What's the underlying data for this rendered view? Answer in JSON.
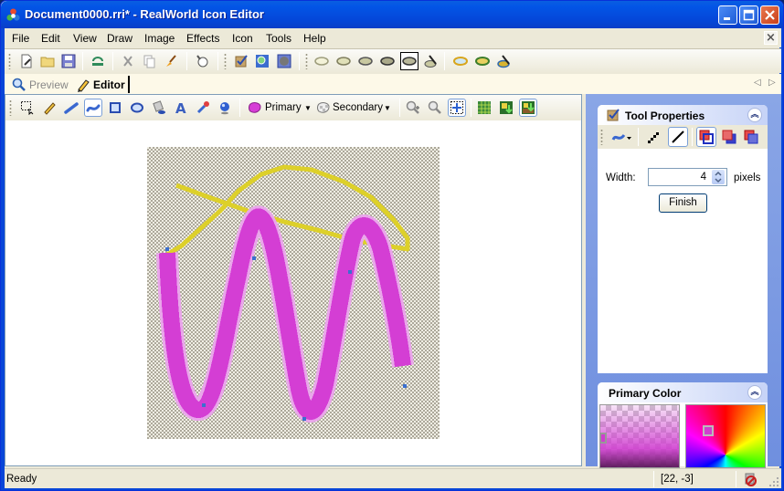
{
  "window": {
    "title": "Document0000.rri* - RealWorld Icon Editor",
    "app_icon": "realworld-app-icon",
    "controls": [
      "minimize",
      "maximize",
      "close"
    ]
  },
  "menubar": {
    "items": [
      {
        "label": "File"
      },
      {
        "label": "Edit"
      },
      {
        "label": "View"
      },
      {
        "label": "Draw"
      },
      {
        "label": "Image"
      },
      {
        "label": "Effects"
      },
      {
        "label": "Icon"
      },
      {
        "label": "Tools"
      },
      {
        "label": "Help"
      }
    ],
    "mdi_close": "×"
  },
  "toolbar_main": {
    "groups": [
      [
        "new-document-icon",
        "open-folder-icon",
        "save-icon"
      ],
      [
        "undo-icon"
      ],
      [
        "cut-icon",
        "copy-icon",
        "paste-brush-icon"
      ],
      [
        "lightbulb-icon"
      ],
      [
        "checkbox-icon",
        "magnify-image-icon",
        "sphere-frame-icon"
      ],
      [
        "lens-1-icon",
        "lens-2-icon",
        "lens-3-icon",
        "lens-4-icon",
        "lens-5-icon",
        "lens-brush-icon"
      ],
      [
        "color-lens-1-icon",
        "color-lens-2-icon",
        "color-lens-brush-icon"
      ]
    ],
    "selected": "lens-5-icon"
  },
  "tabs": {
    "preview": "Preview",
    "editor": "Editor",
    "active": "Editor"
  },
  "toolbar_draw": {
    "tools": [
      "selection-icon",
      "pencil-icon",
      "line-icon",
      "curve-icon",
      "rectangle-icon",
      "ellipse-icon",
      "fill-bucket-icon",
      "text-icon",
      "color-picker-icon",
      "sphere-icon"
    ],
    "selected": "curve-icon",
    "primary_label": "Primary",
    "secondary_label": "Secondary",
    "view_tools": [
      "zoom-in-icon",
      "zoom-out-icon",
      "fit-icon",
      "grid-icon",
      "layer-down-icon",
      "layer-merge-icon"
    ]
  },
  "canvas": {
    "image_size": "32x32 approx",
    "stroke_primary_color": "#d43ed4",
    "stroke_yellow_color": "#ddd02a",
    "control_point_color": "#3a6fcf"
  },
  "tool_properties": {
    "title": "Tool Properties",
    "width_label": "Width:",
    "width_value": "4",
    "width_units": "pixels",
    "finish_label": "Finish"
  },
  "primary_color": {
    "title": "Primary Color",
    "color": "#d03ed0"
  },
  "statusbar": {
    "text": "Ready",
    "coords": "[22, -3]"
  }
}
